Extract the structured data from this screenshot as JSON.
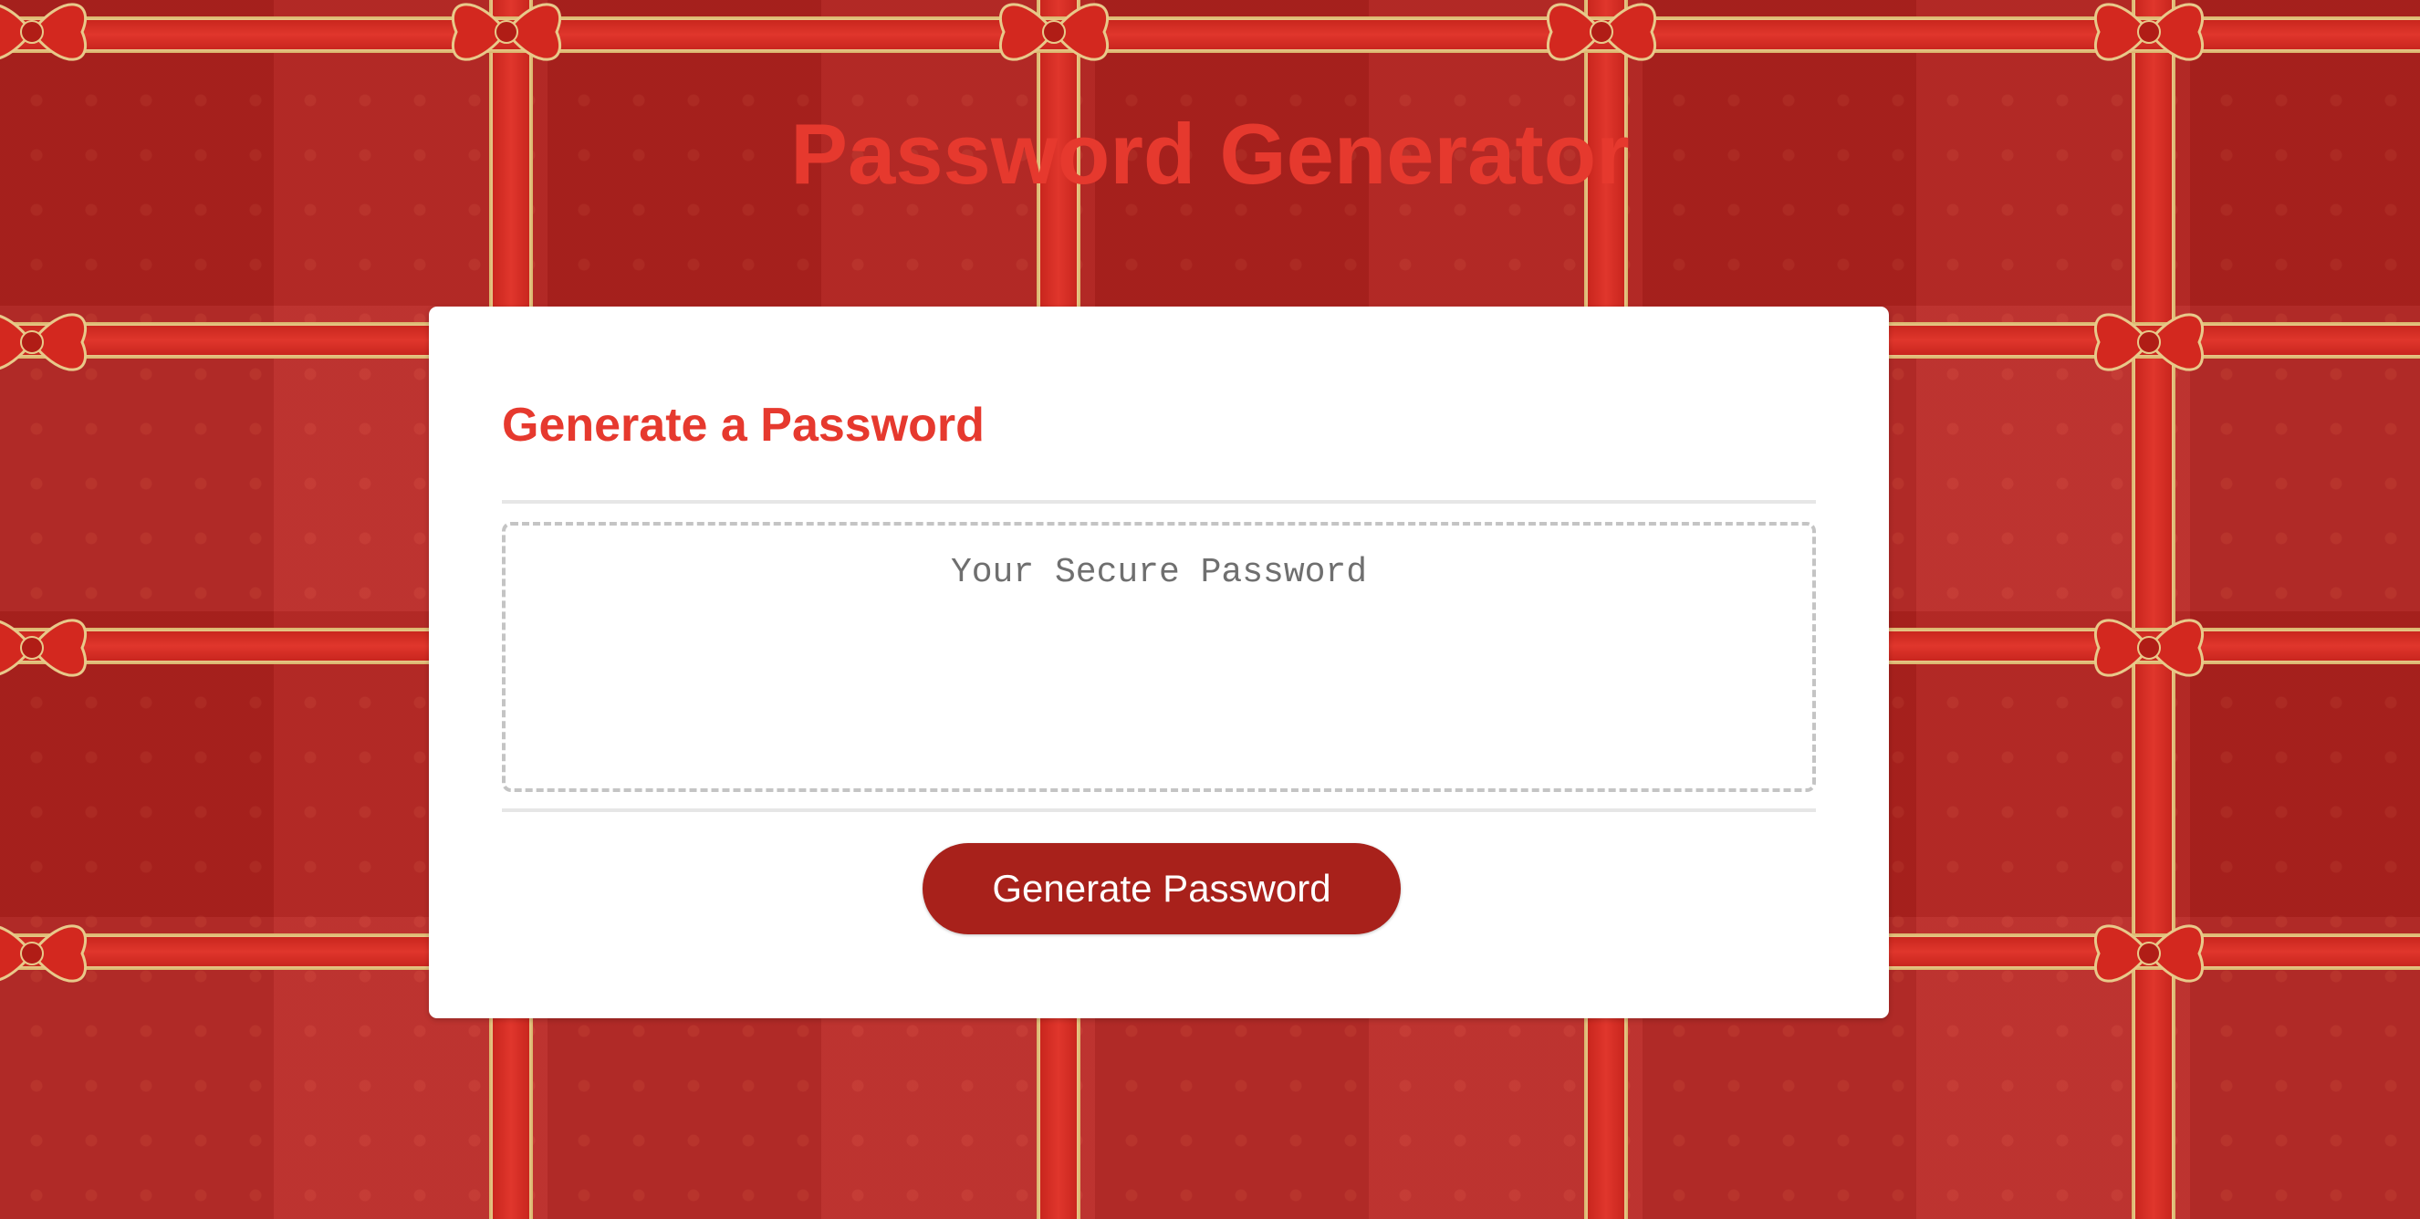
{
  "header": {
    "title": "Password Generator"
  },
  "card": {
    "heading": "Generate a Password",
    "password_field": {
      "placeholder": "Your Secure Password",
      "value": ""
    },
    "generate_button_label": "Generate Password"
  },
  "colors": {
    "title_red": "#e6392e",
    "button_red": "#a8211b",
    "background_red": "#b82420",
    "ribbon_gold": "#d9b36a"
  },
  "background": {
    "pattern": "red-gift-wrap-with-ribbons-and-bows"
  }
}
